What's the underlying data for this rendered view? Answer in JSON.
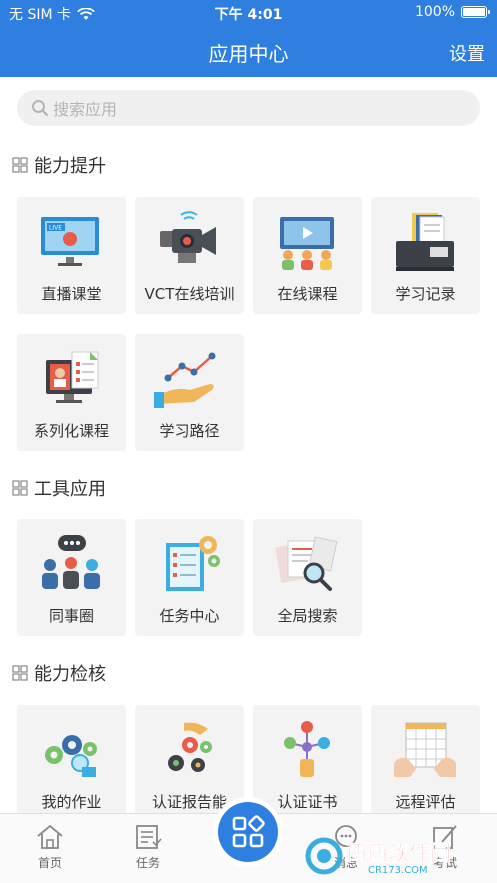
{
  "status_bar": {
    "carrier": "无 SIM 卡",
    "time": "下午 4:01",
    "battery": "100%"
  },
  "nav": {
    "title": "应用中心",
    "settings": "设置"
  },
  "search": {
    "placeholder": "搜索应用"
  },
  "sections": [
    {
      "title": "能力提升",
      "items": [
        {
          "label": "直播课堂",
          "icon": "live-classroom-icon"
        },
        {
          "label": "VCT在线培训",
          "icon": "video-camera-icon"
        },
        {
          "label": "在线课程",
          "icon": "online-course-icon"
        },
        {
          "label": "学习记录",
          "icon": "learning-record-icon"
        },
        {
          "label": "系列化课程",
          "icon": "series-course-icon"
        },
        {
          "label": "学习路径",
          "icon": "learning-path-icon"
        }
      ]
    },
    {
      "title": "工具应用",
      "items": [
        {
          "label": "同事圈",
          "icon": "colleague-circle-icon"
        },
        {
          "label": "任务中心",
          "icon": "task-center-icon"
        },
        {
          "label": "全局搜索",
          "icon": "global-search-icon"
        }
      ]
    },
    {
      "title": "能力检核",
      "items": [
        {
          "label": "我的作业",
          "icon": "homework-icon"
        },
        {
          "label": "认证报告能",
          "icon": "certification-report-icon"
        },
        {
          "label": "认证证书",
          "icon": "certificate-icon"
        },
        {
          "label": "远程评估",
          "icon": "remote-evaluation-icon"
        }
      ]
    }
  ],
  "tabbar": {
    "home": "首页",
    "tasks": "任务",
    "messages": "消息",
    "exam": "考试"
  },
  "watermark": {
    "brand": "西西软件园",
    "site": "CR173.COM"
  },
  "colors": {
    "primary": "#2e7fe0",
    "tile_bg": "#f3f3f3"
  }
}
